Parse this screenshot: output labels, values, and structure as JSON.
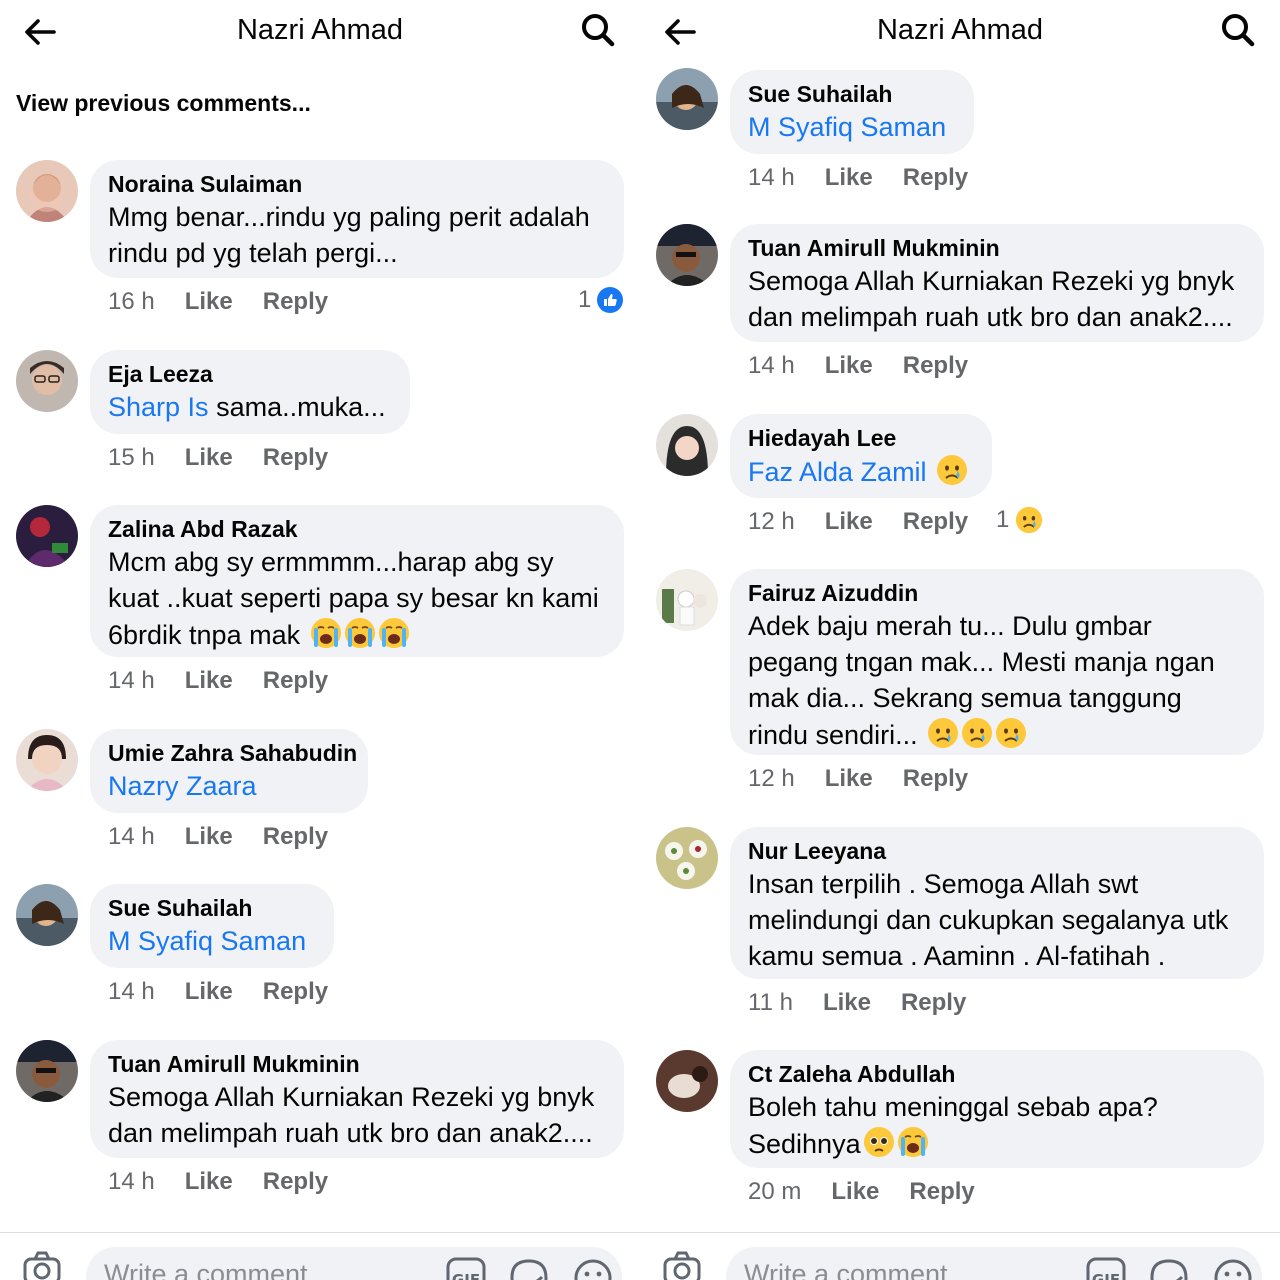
{
  "panels": [
    {
      "title": "Nazri Ahmad",
      "view_previous": "View previous comments...",
      "composer_placeholder": "Write a comment...",
      "comments": [
        {
          "author": "Noraina Sulaiman",
          "lines": [
            "Mmg benar...rindu yg paling perit adalah",
            "rindu pd yg telah pergi..."
          ],
          "time": "16 h",
          "like": "Like",
          "reply": "Reply",
          "reaction_count": "1",
          "reaction": "like-icon"
        },
        {
          "author": "Eja Leeza",
          "mention": "Sharp Is",
          "text_after_mention": " sama..muka...",
          "time": "15 h",
          "like": "Like",
          "reply": "Reply"
        },
        {
          "author": "Zalina Abd Razak",
          "lines": [
            "Mcm abg sy ermmmm...harap abg sy",
            "kuat ..kuat seperti papa sy besar kn kami",
            "6brdik tnpa mak"
          ],
          "emojis": [
            "crying-face-icon",
            "crying-face-icon",
            "crying-face-icon"
          ],
          "time": "14 h",
          "like": "Like",
          "reply": "Reply"
        },
        {
          "author": "Umie Zahra Sahabudin",
          "mention": "Nazry Zaara",
          "time": "14 h",
          "like": "Like",
          "reply": "Reply"
        },
        {
          "author": "Sue Suhailah",
          "mention": "M Syafiq Saman",
          "time": "14 h",
          "like": "Like",
          "reply": "Reply"
        },
        {
          "author": "Tuan Amirull Mukminin",
          "lines": [
            "Semoga Allah Kurniakan Rezeki yg bnyk",
            "dan melimpah ruah utk bro dan anak2...."
          ],
          "time": "14 h",
          "like": "Like",
          "reply": "Reply"
        }
      ]
    },
    {
      "title": "Nazri Ahmad",
      "composer_placeholder": "Write a comment...",
      "comments": [
        {
          "author": "Sue Suhailah",
          "mention": "M Syafiq Saman",
          "time": "14 h",
          "like": "Like",
          "reply": "Reply"
        },
        {
          "author": "Tuan Amirull Mukminin",
          "lines": [
            "Semoga Allah Kurniakan Rezeki yg bnyk",
            "dan melimpah ruah utk bro dan anak2...."
          ],
          "time": "14 h",
          "like": "Like",
          "reply": "Reply"
        },
        {
          "author": "Hiedayah Lee",
          "mention": "Faz Alda Zamil",
          "emojis": [
            "sad-face-icon"
          ],
          "time": "12 h",
          "like": "Like",
          "reply": "Reply",
          "reaction_count": "1",
          "reaction": "sad-reaction-icon"
        },
        {
          "author": "Fairuz Aizuddin",
          "lines": [
            "Adek baju merah tu... Dulu gmbar",
            "pegang tngan mak... Mesti manja ngan",
            "mak dia... Sekrang semua tanggung",
            "rindu sendiri..."
          ],
          "emojis": [
            "sad-face-icon",
            "sad-face-icon",
            "sad-face-icon"
          ],
          "time": "12 h",
          "like": "Like",
          "reply": "Reply"
        },
        {
          "author": "Nur Leeyana",
          "lines": [
            "Insan terpilih . Semoga Allah swt",
            "melindungi dan cukupkan segalanya utk",
            "kamu semua . Aaminn . Al-fatihah ."
          ],
          "time": "11 h",
          "like": "Like",
          "reply": "Reply"
        },
        {
          "author": "Ct Zaleha Abdullah",
          "lines": [
            "Boleh tahu meninggal sebab apa?",
            "Sedihnya"
          ],
          "emojis": [
            "pleading-face-icon",
            "crying-face-icon"
          ],
          "time": "20 m",
          "like": "Like",
          "reply": "Reply"
        }
      ]
    }
  ],
  "colors": {
    "mention": "#1877f2",
    "bubble": "#f0f2f5",
    "meta": "#65676b",
    "like_badge": "#1877f2"
  }
}
